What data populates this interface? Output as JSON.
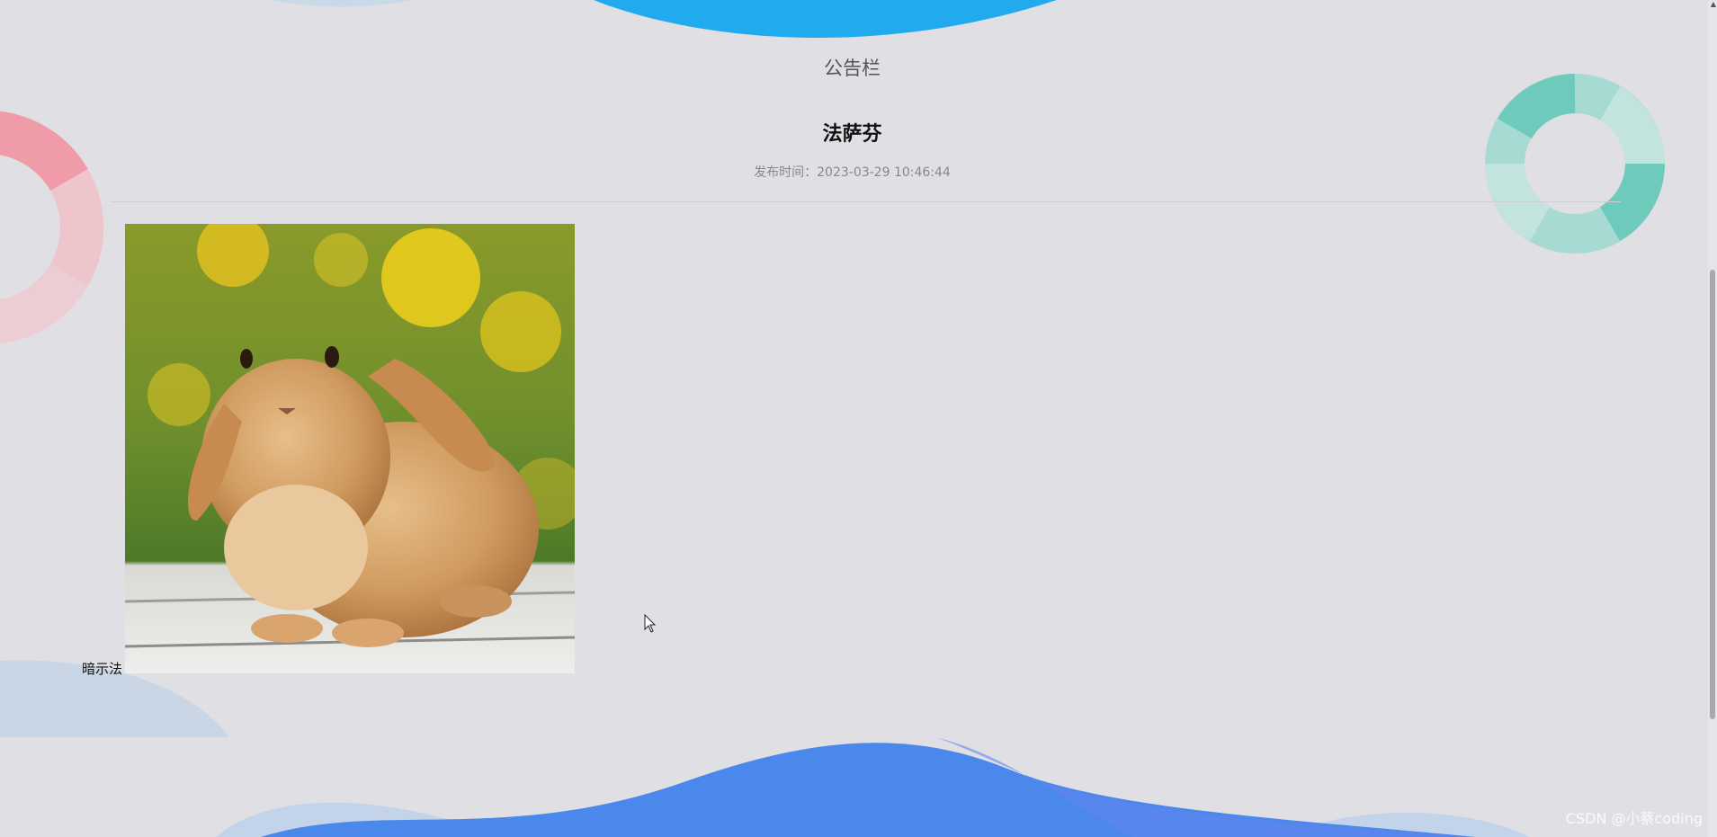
{
  "section": {
    "title": "公告栏"
  },
  "notice": {
    "title": "法萨芬",
    "meta": "发布时间：2023-03-29 10:46:44",
    "image_alt": "rabbit",
    "content_text": "暗示法"
  },
  "watermark": "CSDN @小蔡coding",
  "colors": {
    "background": "#e0dfe3",
    "top_wave": "#22aaee",
    "bottom_wave": "#4a88ec",
    "pink_ring": "#f1a1ac",
    "teal_ring": "#6ecbbc"
  }
}
